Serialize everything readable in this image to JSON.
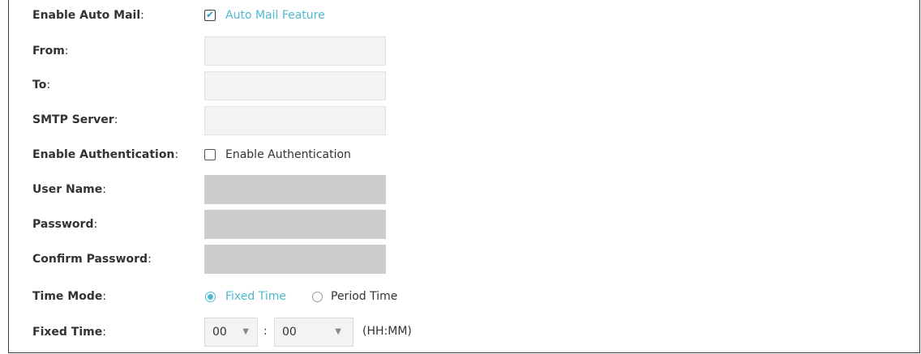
{
  "fields": {
    "enable_auto_mail": {
      "label": "Enable Auto Mail",
      "colon": ":",
      "checkbox_label": "Auto Mail Feature",
      "checked": true
    },
    "from": {
      "label": "From",
      "colon": ":",
      "value": ""
    },
    "to": {
      "label": "To",
      "colon": ":",
      "value": ""
    },
    "smtp_server": {
      "label": "SMTP Server",
      "colon": ":",
      "value": ""
    },
    "enable_authentication": {
      "label": "Enable Authentication",
      "colon": ":",
      "checkbox_label": "Enable Authentication",
      "checked": false
    },
    "user_name": {
      "label": "User Name",
      "colon": ":",
      "value": ""
    },
    "password": {
      "label": "Password",
      "colon": ":",
      "value": ""
    },
    "confirm_password": {
      "label": "Confirm Password",
      "colon": ":",
      "value": ""
    },
    "time_mode": {
      "label": "Time Mode",
      "colon": ":",
      "options": [
        "Fixed Time",
        "Period Time"
      ],
      "selected": "Fixed Time"
    },
    "fixed_time": {
      "label": "Fixed Time",
      "colon": ":",
      "hour": "00",
      "minute": "00",
      "separator": ":",
      "format_hint": "(HH:MM)"
    }
  },
  "colors": {
    "accent": "#4fb9d3",
    "input_bg": "#f3f3f3",
    "disabled_bg": "#cdcdcd",
    "label": "#333333"
  },
  "icons": {
    "checkmark": "checkmark-icon",
    "dropdown": "triangle-down-icon"
  }
}
